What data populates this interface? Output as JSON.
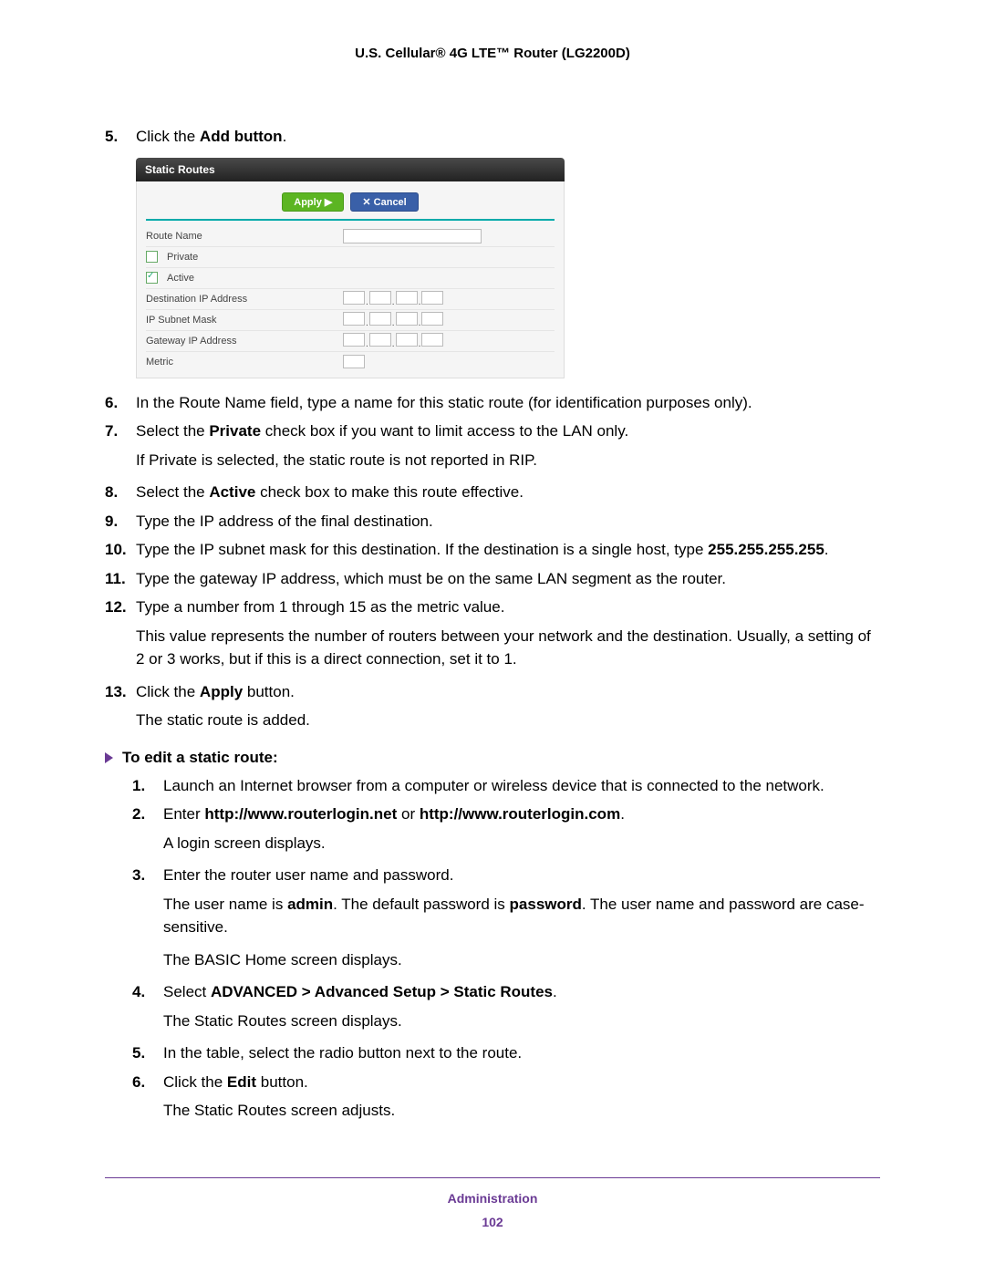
{
  "header": "U.S. Cellular® 4G LTE™ Router (LG2200D)",
  "panel": {
    "title": "Static Routes",
    "apply": "Apply ▶",
    "cancel": "✕ Cancel",
    "rows": {
      "routeName": "Route Name",
      "private": "Private",
      "active": "Active",
      "dest": "Destination IP Address",
      "mask": "IP Subnet Mask",
      "gateway": "Gateway IP Address",
      "metric": "Metric"
    }
  },
  "s5_num": "5.",
  "s5_a": "Click the ",
  "s5_b": "Add button",
  "s5_c": ".",
  "s6_num": "6.",
  "s6": "In the Route Name field, type a name for this static route (for identification purposes only).",
  "s7_num": "7.",
  "s7_a": "Select the ",
  "s7_b": "Private",
  "s7_c": " check box if you want to limit access to the LAN only.",
  "s7_sub": "If Private is selected, the static route is not reported in RIP.",
  "s8_num": "8.",
  "s8_a": "Select the ",
  "s8_b": "Active",
  "s8_c": " check box to make this route effective.",
  "s9_num": "9.",
  "s9": "Type the IP address of the final destination.",
  "s10_num": "10.",
  "s10_a": "Type the IP subnet mask for this destination. If the destination is a single host, type ",
  "s10_b": "255.255.255.255",
  "s10_c": ".",
  "s11_num": "11.",
  "s11": "Type the gateway IP address, which must be on the same LAN segment as the router.",
  "s12_num": "12.",
  "s12": "Type a number from 1 through 15 as the metric value.",
  "s12_sub": "This value represents the number of routers between your network and the destination. Usually, a setting of 2 or 3 works, but if this is a direct connection, set it to 1.",
  "s13_num": "13.",
  "s13_a": "Click the ",
  "s13_b": "Apply",
  "s13_c": " button.",
  "s13_sub": "The static route is added.",
  "section2": "To edit a static route:",
  "e1_num": "1.",
  "e1": "Launch an Internet browser from a computer or wireless device that is connected to the network.",
  "e2_num": "2.",
  "e2_a": "Enter ",
  "e2_b": "http://www.routerlogin.net",
  "e2_c": " or ",
  "e2_d": "http://www.routerlogin.com",
  "e2_e": ".",
  "e2_sub": "A login screen displays.",
  "e3_num": "3.",
  "e3": "Enter the router user name and password.",
  "e3_sub_a": "The user name is ",
  "e3_sub_b": "admin",
  "e3_sub_c": ". The default password is ",
  "e3_sub_d": "password",
  "e3_sub_e": ". The user name and password are case-sensitive.",
  "e3_sub2": "The BASIC Home screen displays.",
  "e4_num": "4.",
  "e4_a": "Select ",
  "e4_b": "ADVANCED > Advanced Setup > Static Routes",
  "e4_c": ".",
  "e4_sub": "The Static Routes screen displays.",
  "e5_num": "5.",
  "e5": "In the table, select the radio button next to the route.",
  "e6_num": "6.",
  "e6_a": "Click the ",
  "e6_b": "Edit",
  "e6_c": " button.",
  "e6_sub": "The Static Routes screen adjusts.",
  "footer_label": "Administration",
  "footer_page": "102"
}
